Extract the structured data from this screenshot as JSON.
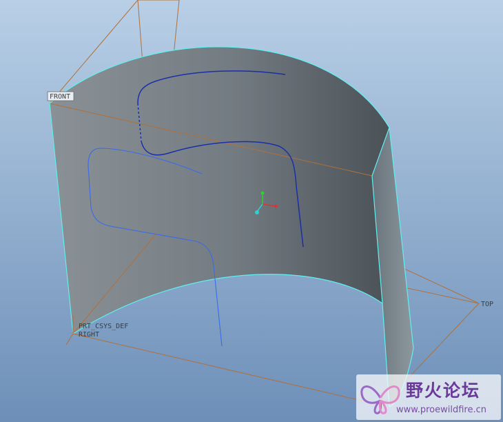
{
  "viewport": {
    "background_top": "#b8cfe6",
    "background_bottom": "#6d8fb8"
  },
  "datum_planes": {
    "front_label": "FRONT",
    "top_label": "TOP",
    "right_label": "RIGHT",
    "plane_color": "#b0703a"
  },
  "coordinate_system": {
    "label": "PRT_CSYS_DEF"
  },
  "surface": {
    "edge_color": "#5ff0f0",
    "curve_color": "#1a2ea8",
    "projected_curve_color": "#3a6ae8"
  },
  "triad": {
    "x_color": "#e03030",
    "y_color": "#30d030",
    "z_color": "#30d0d0"
  },
  "watermark": {
    "title": "野火论坛",
    "url": "www.proewildfire.cn"
  }
}
